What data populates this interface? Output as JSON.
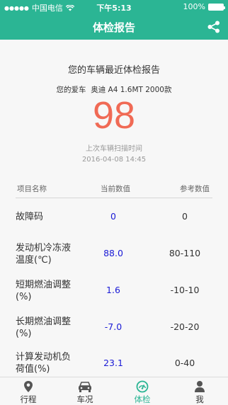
{
  "status_bar": {
    "carrier": "中国电信",
    "time": "下午5:13",
    "battery": "100%"
  },
  "nav": {
    "title": "体检报告"
  },
  "report": {
    "title": "您的车辆最近体检报告",
    "car_prefix": "您的爱车",
    "car_model": "奥迪 A4 1.6MT 2000款",
    "score": "98",
    "scan_label": "上次车辆扫描时间",
    "scan_time": "2016-04-08 14:45"
  },
  "table": {
    "headers": {
      "name": "项目名称",
      "current": "当前数值",
      "reference": "参考数值"
    },
    "rows": [
      {
        "name": "故障码",
        "current": "0",
        "reference": "0"
      },
      {
        "name": "发动机冷冻液温度(℃)",
        "current": "88.0",
        "reference": "80-110"
      },
      {
        "name": "短期燃油调整(%)",
        "current": "1.6",
        "reference": "-10-10"
      },
      {
        "name": "长期燃油调整(%)",
        "current": "-7.0",
        "reference": "-20-20"
      },
      {
        "name": "计算发动机负荷值(%)",
        "current": "23.1",
        "reference": "0-40"
      }
    ]
  },
  "tabs": [
    {
      "label": "行程",
      "icon": "location-pin-icon"
    },
    {
      "label": "车况",
      "icon": "car-icon"
    },
    {
      "label": "体检",
      "icon": "gauge-icon",
      "active": true
    },
    {
      "label": "我",
      "icon": "person-icon"
    }
  ],
  "colors": {
    "accent": "#2bb594",
    "score": "#f06a55",
    "value": "#1a1ad6"
  }
}
